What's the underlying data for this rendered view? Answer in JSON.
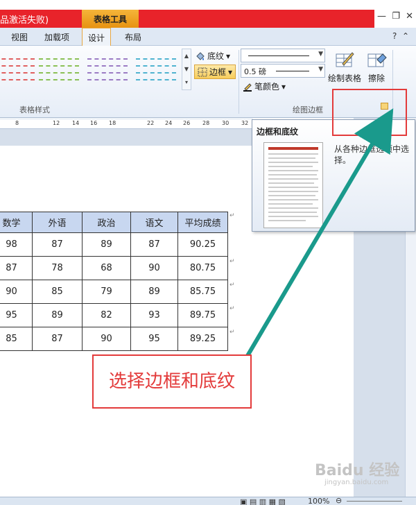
{
  "window": {
    "title_fragment": "品激活失败)",
    "context_tab": "表格工具"
  },
  "tabs": [
    "视图",
    "加载项",
    "设计",
    "布局"
  ],
  "ribbon": {
    "style_group_label": "表格样式",
    "shading_label": "底纹",
    "border_label": "边框",
    "line_weight_value": "0.5 磅",
    "pen_color_label": "笔颜色",
    "draw_table_label": "绘制表格",
    "eraser_label": "擦除",
    "draw_borders_group_label": "绘图边框",
    "style_colors": [
      "#e06060",
      "#8ac055",
      "#9b7bc4",
      "#4fb3d0"
    ]
  },
  "ruler": {
    "ticks": [
      "8",
      "12",
      "14",
      "16",
      "18",
      "22",
      "24",
      "26",
      "28",
      "30",
      "32"
    ]
  },
  "tooltip": {
    "title": "边框和底纹",
    "description": "从各种边框选项中选择。"
  },
  "table": {
    "headers": [
      "数学",
      "外语",
      "政治",
      "语文",
      "平均成绩"
    ],
    "rows": [
      [
        "98",
        "87",
        "89",
        "87",
        "90.25"
      ],
      [
        "87",
        "78",
        "68",
        "90",
        "80.75"
      ],
      [
        "90",
        "85",
        "79",
        "89",
        "85.75"
      ],
      [
        "95",
        "89",
        "82",
        "93",
        "89.75"
      ],
      [
        "85",
        "87",
        "90",
        "95",
        "89.25"
      ]
    ]
  },
  "callout": {
    "text": "选择边框和底纹"
  },
  "status": {
    "zoom": "100%"
  },
  "watermark": {
    "brand": "Baidu 经验",
    "url": "jingyan.baidu.com"
  }
}
